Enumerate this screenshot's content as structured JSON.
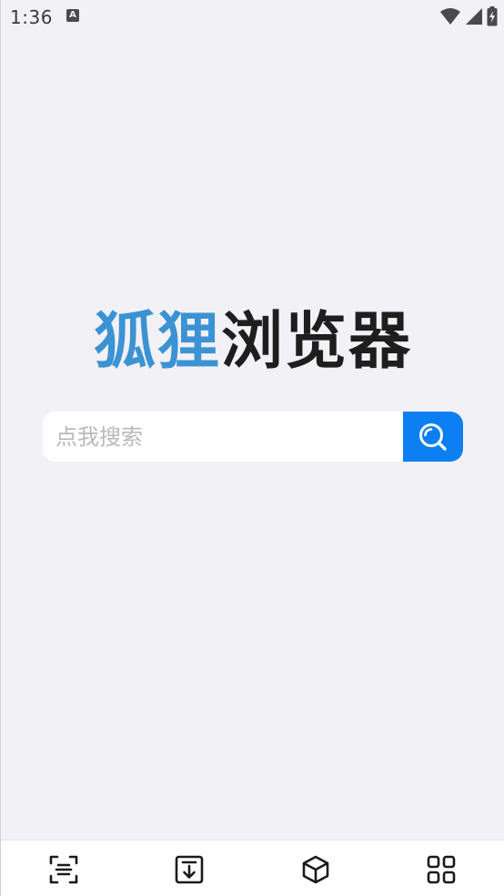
{
  "status_bar": {
    "time": "1:36",
    "notification_glyph": "A",
    "icons": [
      "wifi-icon",
      "signal-icon",
      "battery-charging-icon"
    ]
  },
  "logo": {
    "part1": "狐狸",
    "part2": "浏览器",
    "part1_color": "#3b93d3",
    "part2_color": "#1e1e1e"
  },
  "search": {
    "placeholder": "点我搜索",
    "value": "",
    "button_icon": "search-icon",
    "button_color": "#0c7ff2"
  },
  "bottom_nav": {
    "items": [
      {
        "icon": "scan-icon"
      },
      {
        "icon": "download-icon"
      },
      {
        "icon": "box-icon"
      },
      {
        "icon": "grid-icon"
      }
    ]
  },
  "colors": {
    "background": "#f2f1f6",
    "nav_background": "#ffffff"
  }
}
